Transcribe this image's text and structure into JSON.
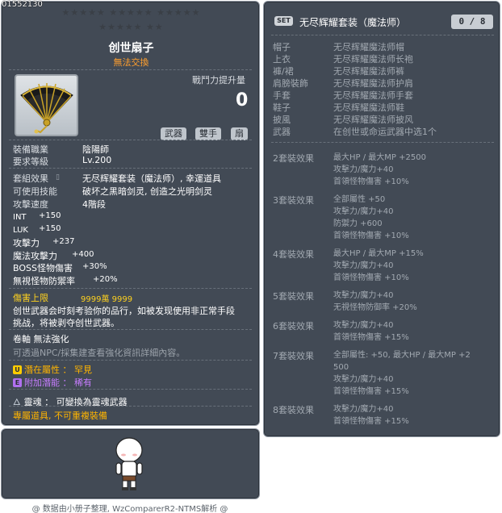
{
  "item_id": "01552130",
  "stars": {
    "row1": "★★★★★  ★★★★★  ★★★★★",
    "row2": "★★★★★  ★★"
  },
  "item": {
    "name": "创世扇子",
    "trade": "無法交換",
    "icon": "fan-weapon-icon",
    "power_label": "戰鬥力提升量",
    "power_value": "0",
    "tags": [
      "武器",
      "雙手",
      "扇"
    ]
  },
  "req": {
    "job_label": "裝備職業",
    "job_value": "陰陽師",
    "level_label": "要求等級",
    "level_value": "Lv.200"
  },
  "effects": {
    "set_label": "套組效果",
    "set_value": "无尽辉耀套装（魔法师）, 幸運道具",
    "skill_label": "可使用技能",
    "skill_value": "破坏之黑暗剑灵, 创造之光明剑灵",
    "speed_label": "攻擊速度",
    "speed_value": "4階段"
  },
  "stats": [
    {
      "label": "INT",
      "value": "+150"
    },
    {
      "label": "LUK",
      "value": "+150"
    },
    {
      "label": "攻擊力",
      "value": "+237"
    },
    {
      "label": "魔法攻擊力",
      "value": "+400"
    },
    {
      "label": "BOSS怪物傷害",
      "value": "+30%"
    },
    {
      "label": "無視怪物防禦率",
      "value": "+20%"
    }
  ],
  "damage_cap": {
    "label": "傷害上限",
    "value": "9999萬 9999"
  },
  "description": {
    "line1": "创世武器会时刻考验你的品行，如被发现使用非正常手段",
    "line2": "挑战，将被剥夺创世武器。"
  },
  "scroll": {
    "label": "卷軸 無法強化",
    "hint": "可透過NPC/採集建查看強化資訊詳細內容。"
  },
  "potential": {
    "badge": "U",
    "label": "潛在屬性 ： 罕見"
  },
  "additional": {
    "badge": "E",
    "label": "附加潛能 ： 稀有"
  },
  "soul": {
    "label": "靈魂 ： 可變換為靈魂武器"
  },
  "exclusive": "專屬道具, 不可重複裝備",
  "set_panel": {
    "badge": "SET",
    "title": "无尽辉耀套装（魔法师）",
    "count": "0 / 8",
    "parts": [
      {
        "slot": "帽子",
        "name": "无尽辉耀魔法师帽"
      },
      {
        "slot": "上衣",
        "name": "无尽辉耀魔法师长袍"
      },
      {
        "slot": "褲/裙",
        "name": "无尽辉耀魔法师裤"
      },
      {
        "slot": "肩膀裝飾",
        "name": "无尽辉耀魔法师护肩"
      },
      {
        "slot": "手套",
        "name": "无尽辉耀魔法师手套"
      },
      {
        "slot": "鞋子",
        "name": "无尽辉耀魔法师鞋"
      },
      {
        "slot": "披風",
        "name": "无尽辉耀魔法师披风"
      },
      {
        "slot": "武器",
        "name": "在创世或命运武器中选1个"
      }
    ],
    "bonuses": [
      {
        "key": "2套裝效果",
        "lines": [
          "最大HP / 最大MP  +2500",
          "攻擊力/魔力+40",
          "首領怪物傷害 +10%"
        ]
      },
      {
        "key": "3套裝效果",
        "lines": [
          "全部屬性 +50",
          "攻擊力/魔力+40",
          "防禦力 +600",
          "首領怪物傷害 +10%"
        ]
      },
      {
        "key": "4套裝效果",
        "lines": [
          "最大HP / 最大MP  +15%",
          "攻擊力/魔力+40",
          "首領怪物傷害 +10%"
        ]
      },
      {
        "key": "5套裝效果",
        "lines": [
          "攻擊力/魔力+40",
          "无視怪物防御率 +20%"
        ]
      },
      {
        "key": "6套裝效果",
        "lines": [
          "攻擊力/魔力+40",
          "首領怪物傷害 +15%"
        ]
      },
      {
        "key": "7套裝效果",
        "lines": [
          "全部屬性: +50, 最大HP / 最大MP  +2",
          "500",
          "攻擊力/魔力+40",
          "首領怪物傷害 +15%"
        ]
      },
      {
        "key": "8套裝效果",
        "lines": [
          "攻擊力/魔力+40",
          "首領怪物傷害 +15%"
        ]
      }
    ]
  },
  "footer": "@ 数据由小册子整理, WzComparerR2-NTMS解析 @"
}
